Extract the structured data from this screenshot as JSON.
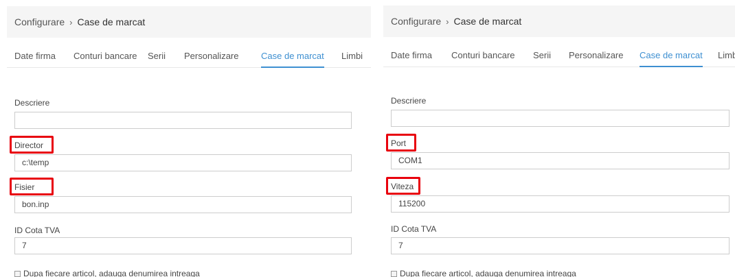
{
  "left": {
    "breadcrumb": {
      "parent": "Configurare",
      "separator": "›",
      "current": "Case de marcat"
    },
    "tabs": [
      {
        "label": "Date firma"
      },
      {
        "label": "Conturi bancare"
      },
      {
        "label": "Serii"
      },
      {
        "label": "Personalizare"
      },
      {
        "label": "Case de marcat",
        "active": true
      },
      {
        "label": "Limbi"
      }
    ],
    "fields": [
      {
        "label": "Descriere",
        "value": ""
      },
      {
        "label": "Director",
        "value": "c:\\temp",
        "highlighted": true
      },
      {
        "label": "Fisier",
        "value": "bon.inp",
        "highlighted": true
      },
      {
        "label": "ID Cota TVA",
        "value": "7"
      }
    ],
    "checkbox": {
      "label": "Dupa fiecare articol, adauga denumirea intreaga",
      "checked": false
    }
  },
  "right": {
    "breadcrumb": {
      "parent": "Configurare",
      "separator": "›",
      "current": "Case de marcat"
    },
    "tabs": [
      {
        "label": "Date firma"
      },
      {
        "label": "Conturi bancare"
      },
      {
        "label": "Serii"
      },
      {
        "label": "Personalizare"
      },
      {
        "label": "Case de marcat",
        "active": true
      },
      {
        "label": "Limb"
      }
    ],
    "fields": [
      {
        "label": "Descriere",
        "value": ""
      },
      {
        "label": "Port",
        "value": "COM1",
        "highlighted": true
      },
      {
        "label": "Viteza",
        "value": "115200",
        "highlighted": true
      },
      {
        "label": "ID Cota TVA",
        "value": "7"
      }
    ],
    "checkbox": {
      "label": "Dupa fiecare articol, adauga denumirea intreaga",
      "checked": false
    }
  },
  "colors": {
    "accent": "#3d8fd1",
    "highlight_box": "#e8000d",
    "breadcrumb_bg": "#f5f5f5"
  }
}
